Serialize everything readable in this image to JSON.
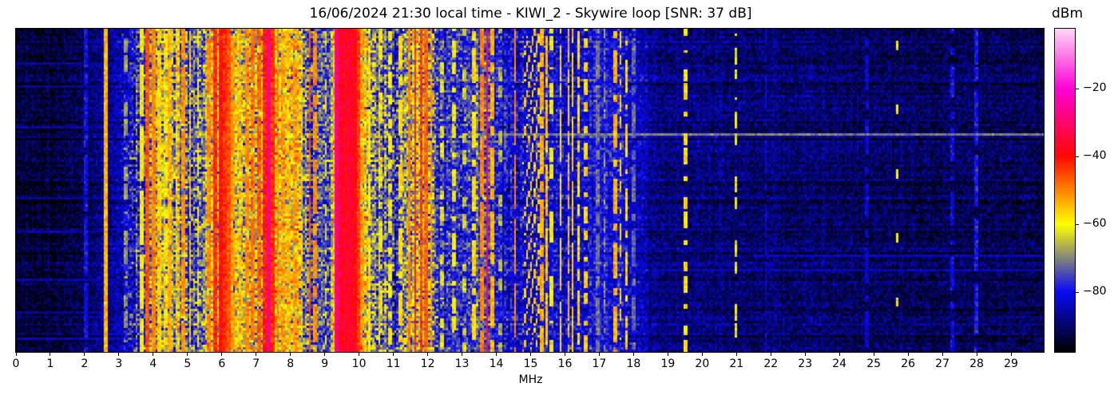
{
  "chart_data": {
    "type": "heatmap",
    "title": "16/06/2024 21:30 local time - KIWI_2 - Skywire loop [SNR: 37 dB]",
    "xlabel": "MHz",
    "x_range": [
      0,
      30
    ],
    "x_ticks": [
      0,
      1,
      2,
      3,
      4,
      5,
      6,
      7,
      8,
      9,
      10,
      11,
      12,
      13,
      14,
      15,
      16,
      17,
      18,
      19,
      20,
      21,
      22,
      23,
      24,
      25,
      26,
      27,
      28,
      29
    ],
    "grid": false,
    "colorbar": {
      "label": "dBm",
      "vmin": -98,
      "vmax": -2,
      "ticks": [
        {
          "value": -20,
          "label": "−20"
        },
        {
          "value": -40,
          "label": "−40"
        },
        {
          "value": -60,
          "label": "−60"
        },
        {
          "value": -80,
          "label": "−80"
        }
      ]
    },
    "colormap": [
      [
        -98,
        "#000000"
      ],
      [
        -80,
        "#0a0af5"
      ],
      [
        -60,
        "#ffff00"
      ],
      [
        -40,
        "#ff0800"
      ],
      [
        -20,
        "#ff00d5"
      ],
      [
        -2,
        "#ffd7f8"
      ]
    ],
    "spectrum": {
      "seed": 1337,
      "rows": 136,
      "cols": 516,
      "envelope_dbm": [
        [
          0,
          -93.5
        ],
        [
          1.6,
          -93
        ],
        [
          2.1,
          -90
        ],
        [
          2.8,
          -86
        ],
        [
          3.3,
          -82
        ],
        [
          3.7,
          -72
        ],
        [
          4.1,
          -67
        ],
        [
          4.7,
          -67
        ],
        [
          5.1,
          -71
        ],
        [
          5.35,
          -74
        ],
        [
          5.6,
          -66
        ],
        [
          6.1,
          -61
        ],
        [
          6.5,
          -63
        ],
        [
          7.1,
          -59
        ],
        [
          7.4,
          -58
        ],
        [
          7.9,
          -62
        ],
        [
          8.35,
          -64
        ],
        [
          8.75,
          -76
        ],
        [
          9.1,
          -73
        ],
        [
          9.35,
          -56
        ],
        [
          9.9,
          -57
        ],
        [
          10.15,
          -65
        ],
        [
          10.5,
          -71
        ],
        [
          11,
          -75
        ],
        [
          11.7,
          -63
        ],
        [
          12.05,
          -66
        ],
        [
          12.45,
          -77
        ],
        [
          13,
          -80
        ],
        [
          13.65,
          -71
        ],
        [
          14.1,
          -81
        ],
        [
          14.6,
          -83
        ],
        [
          15.1,
          -81
        ],
        [
          15.5,
          -79
        ],
        [
          16,
          -83
        ],
        [
          16.7,
          -81
        ],
        [
          17.5,
          -79
        ],
        [
          18,
          -83
        ],
        [
          18.6,
          -87
        ],
        [
          19.2,
          -88.5
        ],
        [
          20,
          -89
        ],
        [
          21,
          -89.5
        ],
        [
          22,
          -90
        ],
        [
          24,
          -90.5
        ],
        [
          26,
          -91
        ],
        [
          28,
          -91
        ],
        [
          30,
          -91.5
        ]
      ],
      "cell_sigma": [
        [
          0,
          2.5
        ],
        [
          3,
          3
        ],
        [
          3.5,
          7
        ],
        [
          8.6,
          7
        ],
        [
          8.9,
          5
        ],
        [
          9.2,
          7
        ],
        [
          12.2,
          7
        ],
        [
          12.5,
          5
        ],
        [
          13.4,
          5
        ],
        [
          14,
          4.5
        ],
        [
          18,
          3.5
        ],
        [
          18.6,
          2.8
        ],
        [
          30,
          2.8
        ]
      ],
      "stripe_sigma": [
        [
          0,
          1.5
        ],
        [
          3.2,
          2
        ],
        [
          3.6,
          6
        ],
        [
          8.6,
          6
        ],
        [
          8.9,
          3
        ],
        [
          9.2,
          6
        ],
        [
          12.2,
          6
        ],
        [
          12.6,
          3.5
        ],
        [
          13.4,
          4
        ],
        [
          14.2,
          3
        ],
        [
          18.2,
          1.5
        ],
        [
          30,
          1.2
        ]
      ],
      "row_sigma": 1.6,
      "carriers": [
        [
          2.02,
          -80,
          0.04,
          0.9
        ],
        [
          2.57,
          -54,
          0.05,
          1
        ],
        [
          3.18,
          -68,
          0.03,
          0.5
        ],
        [
          3.62,
          -60,
          0.04,
          0.8
        ],
        [
          3.8,
          -46,
          0.05,
          1
        ],
        [
          3.96,
          -50,
          0.05,
          1
        ],
        [
          4.15,
          -57,
          0.04,
          0.85
        ],
        [
          4.32,
          -60,
          0.03,
          0.7
        ],
        [
          4.47,
          -54,
          0.05,
          0.9
        ],
        [
          4.65,
          -58,
          0.03,
          0.75
        ],
        [
          4.85,
          -51,
          0.04,
          0.9
        ],
        [
          5.06,
          -55,
          0.04,
          0.8
        ],
        [
          5.3,
          -60,
          0.03,
          0.6
        ],
        [
          5.62,
          -50,
          0.04,
          0.9
        ],
        [
          5.8,
          -43,
          0.06,
          1
        ],
        [
          5.96,
          -40,
          0.06,
          1
        ],
        [
          6.07,
          -43,
          0.05,
          1
        ],
        [
          6.18,
          -46,
          0.04,
          1
        ],
        [
          6.32,
          -52,
          0.04,
          0.9
        ],
        [
          6.52,
          -55,
          0.03,
          0.8
        ],
        [
          6.7,
          -51,
          0.04,
          0.85
        ],
        [
          6.88,
          -49,
          0.04,
          0.9
        ],
        [
          7.06,
          -47,
          0.04,
          0.9
        ],
        [
          7.22,
          -42,
          0.05,
          1
        ],
        [
          7.35,
          -28,
          0.05,
          1
        ],
        [
          7.49,
          -43,
          0.04,
          1
        ],
        [
          7.62,
          -50,
          0.03,
          0.85
        ],
        [
          7.78,
          -52,
          0.04,
          0.8
        ],
        [
          7.95,
          -55,
          0.04,
          0.75
        ],
        [
          8.12,
          -52,
          0.03,
          0.8
        ],
        [
          8.3,
          -55,
          0.03,
          0.7
        ],
        [
          8.55,
          -46,
          0.04,
          0.9
        ],
        [
          8.68,
          -51,
          0.03,
          0.8
        ],
        [
          9.0,
          -62,
          0.03,
          0.5
        ],
        [
          9.35,
          -28,
          0.06,
          1
        ],
        [
          9.42,
          -36,
          0.08,
          1
        ],
        [
          9.56,
          -37,
          0.08,
          1
        ],
        [
          9.7,
          -36,
          0.08,
          1
        ],
        [
          9.85,
          -38,
          0.07,
          1
        ],
        [
          9.95,
          -44,
          0.05,
          1
        ],
        [
          10.1,
          -53,
          0.04,
          0.85
        ],
        [
          10.3,
          -58,
          0.03,
          0.7
        ],
        [
          10.6,
          -62,
          0.03,
          0.5
        ],
        [
          10.9,
          -60,
          0.03,
          0.55
        ],
        [
          11.18,
          -57,
          0.03,
          0.6
        ],
        [
          11.45,
          -50,
          0.04,
          0.85
        ],
        [
          11.63,
          -42,
          0.05,
          1
        ],
        [
          11.8,
          -44,
          0.05,
          1
        ],
        [
          11.95,
          -47,
          0.04,
          0.95
        ],
        [
          12.1,
          -52,
          0.03,
          0.85
        ],
        [
          12.4,
          -62,
          0.03,
          0.45
        ],
        [
          12.75,
          -60,
          0.03,
          0.5
        ],
        [
          13.05,
          -64,
          0.03,
          0.4
        ],
        [
          13.35,
          -58,
          0.03,
          0.6
        ],
        [
          13.57,
          -50,
          0.03,
          0.85
        ],
        [
          13.72,
          -33,
          0.05,
          1
        ],
        [
          13.88,
          -54,
          0.03,
          0.7
        ],
        [
          14.1,
          -66,
          0.03,
          0.4
        ],
        [
          14.53,
          -50,
          0.04,
          0.85
        ],
        [
          15.33,
          -54,
          0.03,
          0.8
        ],
        [
          15.47,
          -55,
          0.03,
          0.7
        ],
        [
          15.62,
          -60,
          0.03,
          0.5
        ],
        [
          15.86,
          -58,
          0.025,
          0.7
        ],
        [
          16.1,
          -55,
          0.025,
          0.9
        ],
        [
          16.22,
          -57,
          0.025,
          0.85
        ],
        [
          16.38,
          -57,
          0.025,
          0.8
        ],
        [
          16.6,
          -57,
          0.03,
          0.5
        ],
        [
          16.95,
          -72,
          0.04,
          0.8
        ],
        [
          17.15,
          -68,
          0.03,
          0.5
        ],
        [
          17.48,
          -54,
          0.04,
          0.6
        ],
        [
          17.62,
          -58,
          0.03,
          0.5
        ],
        [
          17.8,
          -57,
          0.03,
          0.55
        ],
        [
          18.0,
          -73,
          0.03,
          0.6
        ],
        [
          19.5,
          -58,
          0.022,
          0.5
        ],
        [
          20.98,
          -62,
          0.022,
          0.45
        ],
        [
          21.86,
          -82,
          0.03,
          0.6
        ],
        [
          24.8,
          -83,
          0.03,
          0.6
        ],
        [
          25.7,
          -60,
          0.02,
          0.12
        ],
        [
          27.3,
          -81,
          0.025,
          0.6
        ],
        [
          28.0,
          -79,
          0.03,
          0.75
        ]
      ],
      "streaks": [
        {
          "y": 0.325,
          "f0": 13.0,
          "f1": 30.0,
          "level": -71
        },
        {
          "y": 0.325,
          "f0": 9.0,
          "f1": 13.0,
          "level": -77
        },
        {
          "y": 0.695,
          "f0": 21.5,
          "f1": 30.0,
          "level": -84
        },
        {
          "y": 0.745,
          "f0": 18.0,
          "f1": 30.0,
          "level": -85
        },
        {
          "y": 0.1,
          "f0": 0.0,
          "f1": 3.3,
          "level": -86
        },
        {
          "y": 0.175,
          "f0": 0.0,
          "f1": 3.3,
          "level": -87
        },
        {
          "y": 0.3,
          "f0": 0.0,
          "f1": 2.6,
          "level": -86
        },
        {
          "y": 0.525,
          "f0": 0.0,
          "f1": 3.3,
          "level": -87
        },
        {
          "y": 0.625,
          "f0": 0.0,
          "f1": 2.6,
          "level": -86
        },
        {
          "y": 0.775,
          "f0": 0.0,
          "f1": 3.3,
          "level": -86
        },
        {
          "y": 0.875,
          "f0": 0.0,
          "f1": 2.6,
          "level": -87
        },
        {
          "y": 0.955,
          "f0": 0.0,
          "f1": 13.0,
          "level": -84
        }
      ],
      "diagonals": {
        "f0": 14.78,
        "span": 0.5,
        "level": -56,
        "series": [
          0,
          11,
          22
        ],
        "period": 34,
        "duty": 0.8
      }
    }
  }
}
